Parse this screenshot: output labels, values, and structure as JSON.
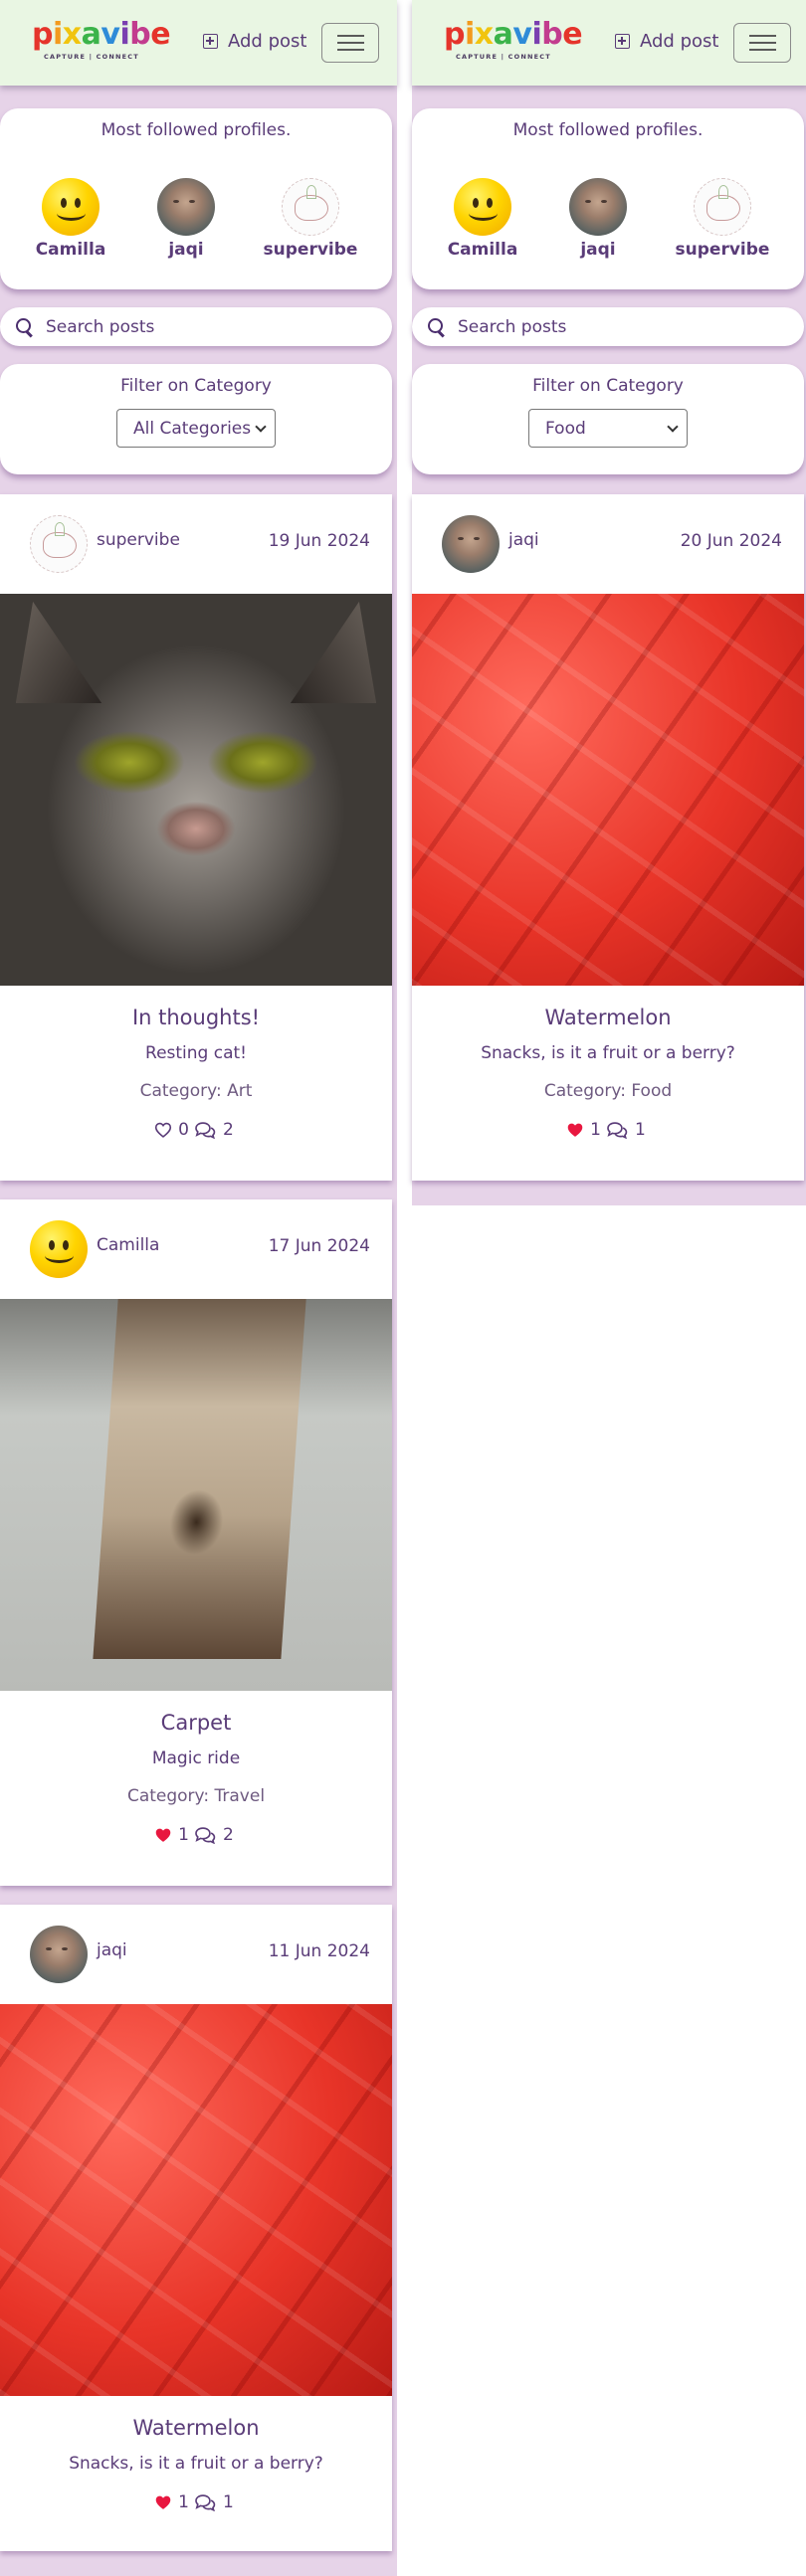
{
  "app": {
    "brand": "pixavibe",
    "tagline": "CAPTURE | CONNECT",
    "add_post_label": "Add post",
    "brand_colors": [
      "#e5342b",
      "#f39a1e",
      "#f1c40f",
      "#3bb34a",
      "#2e8bd8",
      "#7a3fb0",
      "#c23c8e",
      "#e5342b"
    ]
  },
  "profiles": {
    "title": "Most followed profiles.",
    "items": [
      {
        "name": "Camilla",
        "avatar": "smiley-icon"
      },
      {
        "name": "jaqi",
        "avatar": "photo-avatar"
      },
      {
        "name": "supervibe",
        "avatar": "doodle-avatar"
      }
    ]
  },
  "search": {
    "placeholder": "Search posts"
  },
  "filter": {
    "title": "Filter on Category"
  },
  "left": {
    "filter_selected": "All Categories",
    "posts": [
      {
        "user": "supervibe",
        "date": "19 Jun 2024",
        "title": "In thoughts!",
        "description": "Resting cat!",
        "category": "Category: Art",
        "likes": "0",
        "comments": "2",
        "liked": false
      },
      {
        "user": "Camilla",
        "date": "17 Jun 2024",
        "title": "Carpet",
        "description": "Magic ride",
        "category": "Category: Travel",
        "likes": "1",
        "comments": "2",
        "liked": true
      },
      {
        "user": "jaqi",
        "date": "11 Jun 2024",
        "title": "Watermelon",
        "description": "Snacks, is it a fruit or a berry?",
        "likes": "1",
        "comments": "1",
        "liked": true
      }
    ]
  },
  "right": {
    "filter_selected": "Food",
    "posts": [
      {
        "user": "jaqi",
        "date": "20 Jun 2024",
        "title": "Watermelon",
        "description": "Snacks, is it a fruit or a berry?",
        "category": "Category: Food",
        "likes": "1",
        "comments": "1",
        "liked": true
      }
    ]
  },
  "colors": {
    "text": "#5a3c78",
    "navbar_bg": "#e9f6e3",
    "page_bg": "#e6d3e8",
    "heart_filled": "#e8173f"
  }
}
